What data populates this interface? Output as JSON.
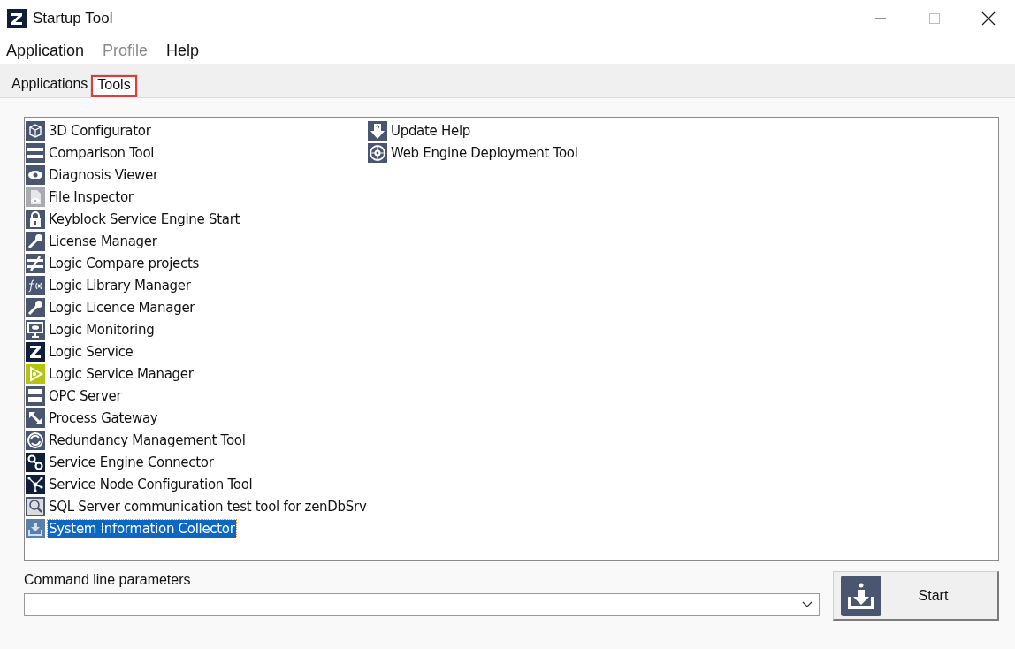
{
  "window": {
    "title": "Startup Tool"
  },
  "menu": [
    {
      "label": "Application",
      "disabled": false
    },
    {
      "label": "Profile",
      "disabled": true
    },
    {
      "label": "Help",
      "disabled": false
    }
  ],
  "tabs": [
    {
      "label": "Applications",
      "selected": false,
      "highlighted": false
    },
    {
      "label": "Tools",
      "selected": true,
      "highlighted": true
    }
  ],
  "tools": [
    {
      "label": "3D Configurator",
      "selected": false
    },
    {
      "label": "Comparison Tool",
      "selected": false
    },
    {
      "label": "Diagnosis Viewer",
      "selected": false
    },
    {
      "label": "File Inspector",
      "selected": false
    },
    {
      "label": "Keyblock Service Engine Start",
      "selected": false
    },
    {
      "label": "License Manager",
      "selected": false
    },
    {
      "label": "Logic Compare projects",
      "selected": false
    },
    {
      "label": "Logic Library Manager",
      "selected": false
    },
    {
      "label": "Logic Licence Manager",
      "selected": false
    },
    {
      "label": "Logic Monitoring",
      "selected": false
    },
    {
      "label": "Logic Service",
      "selected": false
    },
    {
      "label": "Logic Service Manager",
      "selected": false
    },
    {
      "label": "OPC Server",
      "selected": false
    },
    {
      "label": "Process Gateway",
      "selected": false
    },
    {
      "label": "Redundancy Management Tool",
      "selected": false
    },
    {
      "label": "Service Engine Connector",
      "selected": false
    },
    {
      "label": "Service Node Configuration Tool",
      "selected": false
    },
    {
      "label": "SQL Server communication test tool for zenDbSrv",
      "selected": false
    },
    {
      "label": "System Information Collector",
      "selected": true
    },
    {
      "label": "Update Help",
      "selected": false
    },
    {
      "label": "Web Engine Deployment Tool",
      "selected": false
    }
  ],
  "command_line": {
    "label": "Command line parameters"
  },
  "start_button": {
    "label": "Start"
  }
}
